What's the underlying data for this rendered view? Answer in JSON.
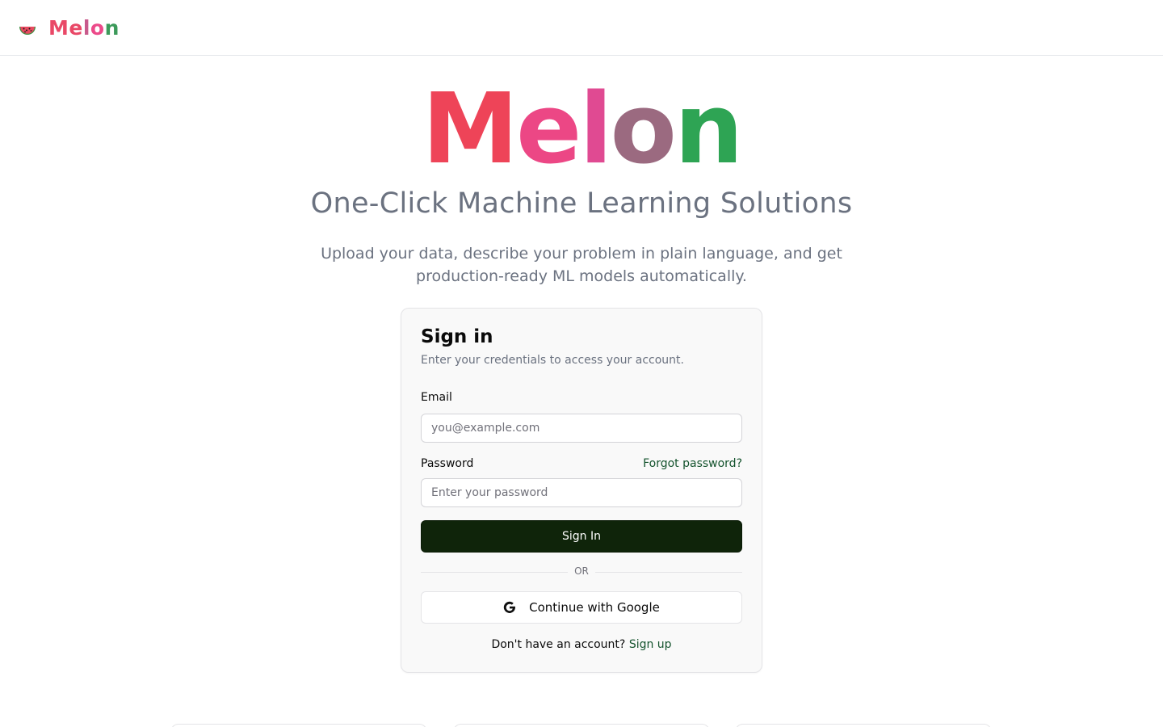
{
  "header": {
    "brand_icon": "watermelon-icon",
    "brand_parts": [
      "Me",
      "l",
      "o",
      "n"
    ]
  },
  "hero": {
    "title_parts": [
      "M",
      "e",
      "l",
      "o",
      "n"
    ],
    "subtitle": "One-Click Machine Learning Solutions",
    "description": "Upload your data, describe your problem in plain language, and get production-ready ML models automatically."
  },
  "signin": {
    "title": "Sign in",
    "description": "Enter your credentials to access your account.",
    "email_label": "Email",
    "email_placeholder": "you@example.com",
    "password_label": "Password",
    "password_placeholder": "Enter your password",
    "forgot_label": "Forgot password?",
    "submit_label": "Sign In",
    "divider_label": "OR",
    "google_label": "Continue with Google",
    "google_icon": "google-icon",
    "no_account_text": "Don't have an account?",
    "signup_label": "Sign up"
  },
  "colors": {
    "accent_dark": "#0f240a",
    "link": "#14532d",
    "brand_red": "#ee4458",
    "brand_pink": "#ec4785",
    "brand_green": "#2ea454"
  }
}
